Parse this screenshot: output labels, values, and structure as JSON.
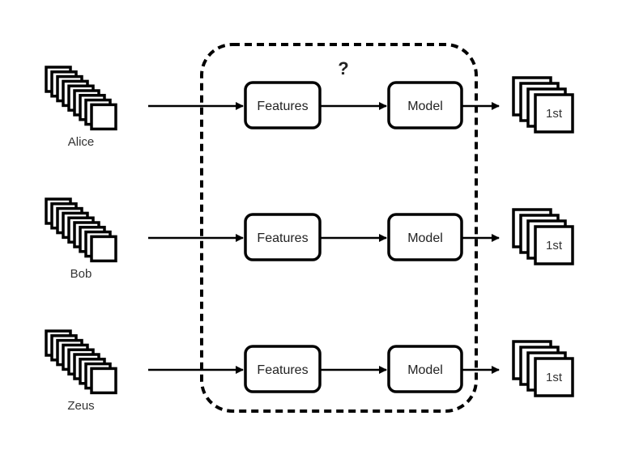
{
  "diagram": {
    "question_mark": "?",
    "rows": [
      {
        "person": "Alice",
        "features_label": "Features",
        "model_label": "Model",
        "output_label": "1st"
      },
      {
        "person": "Bob",
        "features_label": "Features",
        "model_label": "Model",
        "output_label": "1st"
      },
      {
        "person": "Zeus",
        "features_label": "Features",
        "model_label": "Model",
        "output_label": "1st"
      }
    ],
    "colors": {
      "stroke": "#000000",
      "text": "#333333",
      "background": "#ffffff"
    }
  }
}
